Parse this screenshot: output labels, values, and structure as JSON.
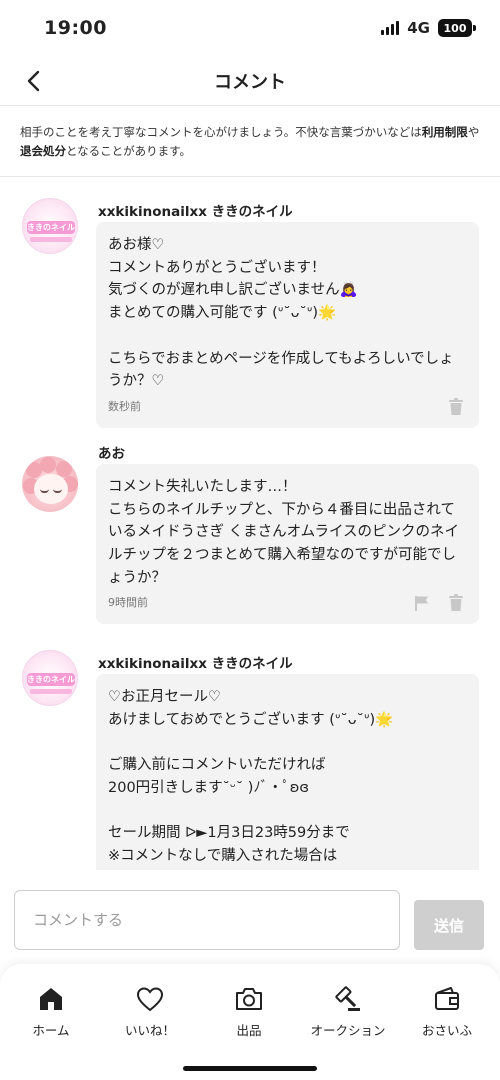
{
  "status_bar": {
    "time": "19:00",
    "network": "4G",
    "battery": "100"
  },
  "header": {
    "title": "コメント",
    "back_icon": "chevron-left-icon"
  },
  "notice": {
    "text_before": "相手のことを考え丁寧なコメントを心がけましょう。不快な言葉づかいなどは",
    "bold1": "利用制限",
    "text_middle": "や",
    "bold2": "退会処分",
    "text_after": "となることがあります。"
  },
  "comments": [
    {
      "author": "xxkikinonailxx ききのネイル",
      "avatar_text": "ききのネイル",
      "text": "あお様♡\nコメントありがとうございます！\n気づくのが遅れ申し訳ございません🙇‍♀️\nまとめての購入可能です (ᐡ˘ᴗ˘ᐡ)🌟\n\nこちらでおまとめページを作成してもよろしいでしょうか？♡",
      "time": "数秒前",
      "actions": [
        "trash-icon"
      ]
    },
    {
      "author": "あお",
      "text": "コメント失礼いたします…！\nこちらのネイルチップと、下から４番目に出品されているメイドうさぎ くまさんオムライスのピンクのネイルチップを２つまとめて購入希望なのですが可能でしょうか？",
      "time": "9時間前",
      "actions": [
        "flag-icon",
        "trash-icon"
      ]
    },
    {
      "author": "xxkikinonailxx ききのネイル",
      "avatar_text": "ききのネイル",
      "text": "♡お正月セール♡\nあけましておめでとうございます (ᐡ˘ᴗ˘ᐡ)🌟\n\nご購入前にコメントいただければ\n200円引きします˘ᵕ˘ )ﾉﾞ・ﾟʚɞ\n\nセール期間 ᐅ►1月3日23時59分まで\n※コメントなしで購入された場合は\nお値引き出来ませんのでご注意ください。",
      "time": "",
      "actions": []
    }
  ],
  "input": {
    "placeholder": "コメントする",
    "send_label": "送信"
  },
  "tabs": [
    {
      "label": "ホーム",
      "icon": "home-icon"
    },
    {
      "label": "いいね！",
      "icon": "heart-icon"
    },
    {
      "label": "出品",
      "icon": "camera-icon"
    },
    {
      "label": "オークション",
      "icon": "gavel-icon"
    },
    {
      "label": "おさいふ",
      "icon": "wallet-icon"
    }
  ]
}
